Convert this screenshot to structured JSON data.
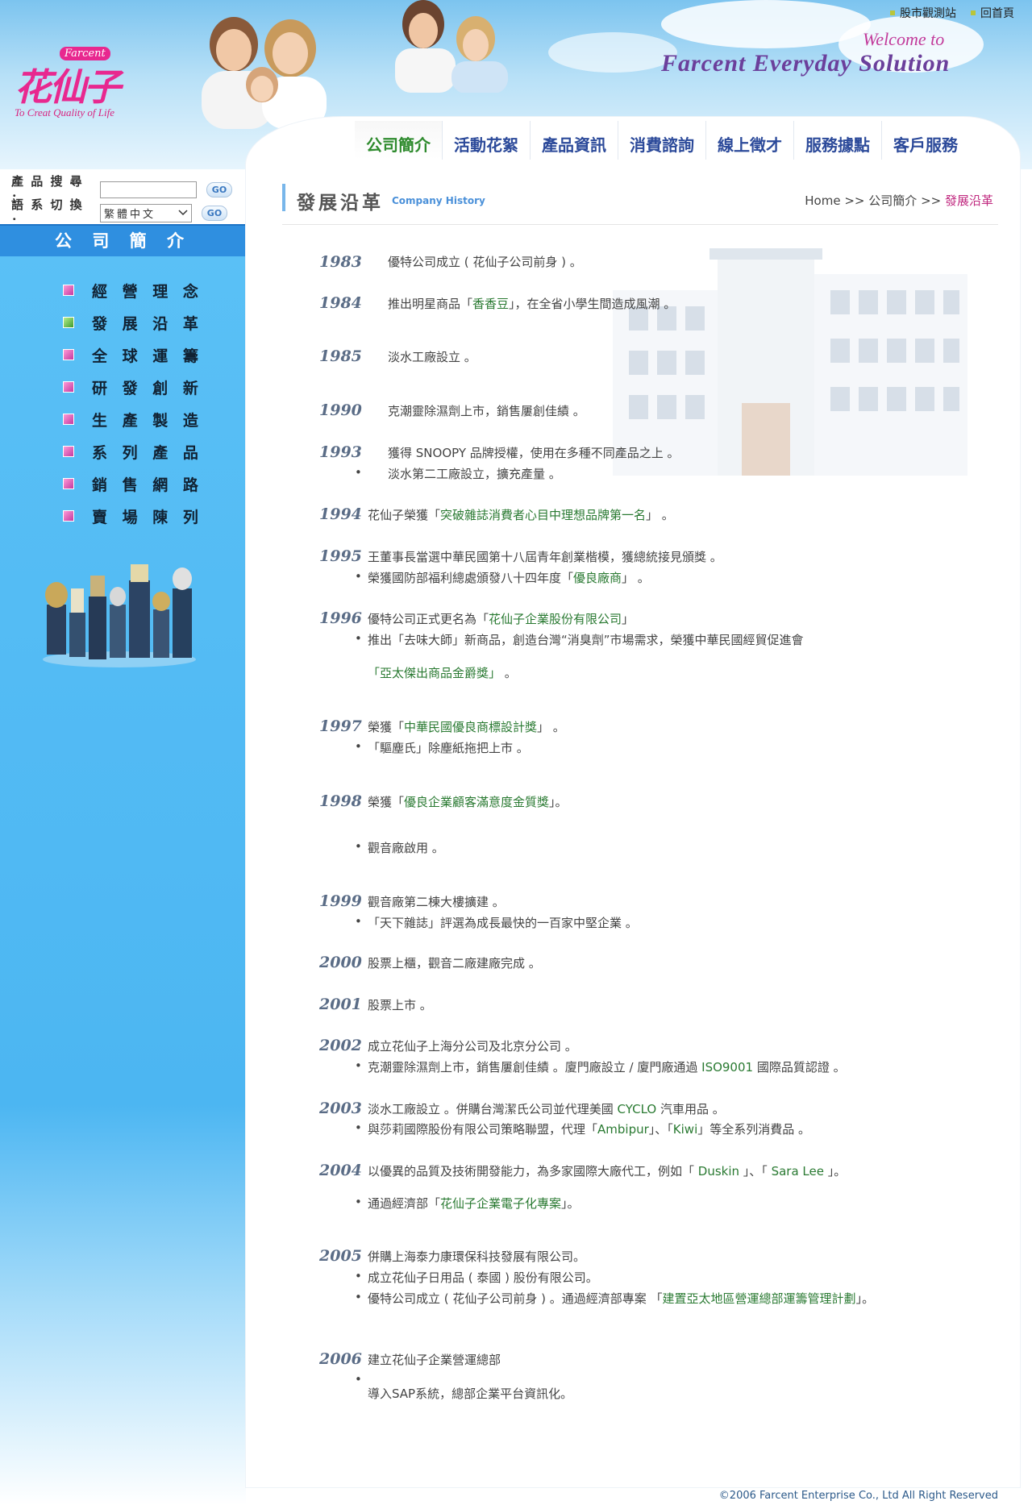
{
  "header": {
    "logo_brand": "Farcent",
    "logo_cn": "花仙子",
    "logo_tagline": "To Creat Quality of Life",
    "welcome": "Welcome to",
    "slogan": "Farcent  Everyday  Solution",
    "top_links": [
      "股市觀測站",
      "回首頁"
    ]
  },
  "nav": {
    "items": [
      "公司簡介",
      "活動花絮",
      "產品資訊",
      "消費諮詢",
      "線上徵才",
      "服務據點",
      "客戶服務"
    ],
    "active_index": 0
  },
  "sidebar": {
    "search_label": "產 品 搜 尋 ：",
    "search_value": "",
    "lang_label": "語 系 切 換 ：",
    "lang_selected": "繁體中文",
    "go_label": "GO",
    "section_title": "公 司 簡 介",
    "menu": [
      "經 營 理 念",
      "發 展 沿 革",
      "全 球 運 籌",
      "研 發 創 新",
      "生 產 製 造",
      "系 列 產 品",
      "銷 售 網 路",
      "賣 場 陳 列"
    ],
    "menu_active_index": 1
  },
  "content": {
    "title": "發展沿革",
    "subtitle": "Company History",
    "breadcrumb_home": "Home",
    "breadcrumb_sep": ">>",
    "breadcrumb_mid": "公司簡介",
    "breadcrumb_current": "發展沿革"
  },
  "timeline": {
    "y1983": "1983",
    "e1983": "優特公司成立 ( 花仙子公司前身 ) 。",
    "y1984": "1984",
    "e1984a": "推出明星商品「",
    "e1984b": "香香豆",
    "e1984c": "」，在全省小學生間造成風潮 。",
    "y1985": "1985",
    "e1985": "淡水工廠設立 。",
    "y1990": "1990",
    "e1990": "克潮靈除濕劑上市，銷售屢創佳績 。",
    "y1993": "1993",
    "e1993a": "獲得 SNOOPY 品牌授權，使用在多種不同產品之上 。",
    "e1993b": "淡水第二工廠設立，擴充產量 。",
    "y1994": "1994",
    "e1994a": "花仙子榮獲「",
    "e1994b": "突破雜誌消費者心目中理想品牌第一名",
    "e1994c": "」 。",
    "y1995": "1995",
    "e1995a": "王董事長當選中華民國第十八屆青年創業楷模，獲總統接見頒獎 。",
    "e1995b": "榮獲國防部福利總處頒發八十四年度「",
    "e1995c": "優良廠商",
    "e1995d": "」 。",
    "y1996": "1996",
    "e1996a": "優特公司正式更名為「",
    "e1996b": "花仙子企業股份有限公司",
    "e1996c": "」",
    "e1996d": "推出「去味大師」新商品，創造台灣“消臭劑”市場需求，榮獲中華民國經貿促進會",
    "e1996e": "「亞太傑出商品金爵獎」",
    "e1996f": " 。",
    "y1997": "1997",
    "e1997a": "榮獲「",
    "e1997b": "中華民國優良商標設計獎",
    "e1997c": "」 。",
    "e1997d": "「驅塵氏」除塵紙拖把上市 。",
    "y1998": "1998",
    "e1998a": "榮獲「",
    "e1998b": "優良企業顧客滿意度金質獎",
    "e1998c": "」。",
    "e1998d": "觀音廠啟用 。",
    "y1999": "1999",
    "e1999a": "觀音廠第二棟大樓擴建 。",
    "e1999b": "「天下雜誌」評選為成長最快的一百家中堅企業 。",
    "y2000": "2000",
    "e2000": "股票上櫃，觀音二廠建廠完成 。",
    "y2001": "2001",
    "e2001": "股票上市 。",
    "y2002": "2002",
    "e2002a": "成立花仙子上海分公司及北京分公司 。",
    "e2002b": "克潮靈除濕劑上市，銷售屢創佳績 。廈門廠設立 / 廈門廠通過 ",
    "e2002c": "ISO9001",
    "e2002d": " 國際品質認證 。",
    "y2003": "2003",
    "e2003a": "淡水工廠設立 。併購台灣潔氏公司並代理美國 ",
    "e2003b": "CYCLO",
    "e2003c": " 汽車用品 。",
    "e2003d": "與莎莉國際股份有限公司策略聯盟，代理「",
    "e2003e": "Ambipur",
    "e2003f": "」、「",
    "e2003g": "Kiwi",
    "e2003h": "」等全系列消費品 。",
    "y2004": "2004",
    "e2004a": "以優異的品質及技術開發能力，為多家國際大廠代工，例如「 ",
    "e2004b": "Duskin",
    "e2004c": " 」、「 ",
    "e2004d": "Sara Lee",
    "e2004e": " 」。",
    "e2004f": "通過經濟部「",
    "e2004g": "花仙子企業電子化專案",
    "e2004h": "」。",
    "y2005": "2005",
    "e2005a": "併購上海泰力康環保科技發展有限公司。",
    "e2005b": "成立花仙子日用品 ( 泰國 ) 股份有限公司。",
    "e2005c": "優特公司成立 ( 花仙子公司前身 ) 。通過經濟部專案 「",
    "e2005d": "建置亞太地區營運總部運籌管理計劃",
    "e2005e": "」。",
    "y2006": "2006",
    "e2006a": "建立花仙子企業營運總部",
    "e2006b": "導入SAP系統，總部企業平台資訊化。"
  },
  "footer": {
    "copyright": "©2006 Farcent Enterprise Co., Ltd All Right Reserved"
  },
  "colors": {
    "brand_pink": "#e8288f",
    "nav_blue": "#2c4a9a",
    "nav_active_green": "#2f8b2e",
    "sidebar_blue": "#4cb6f2",
    "highlight_green": "#2a7a32"
  }
}
